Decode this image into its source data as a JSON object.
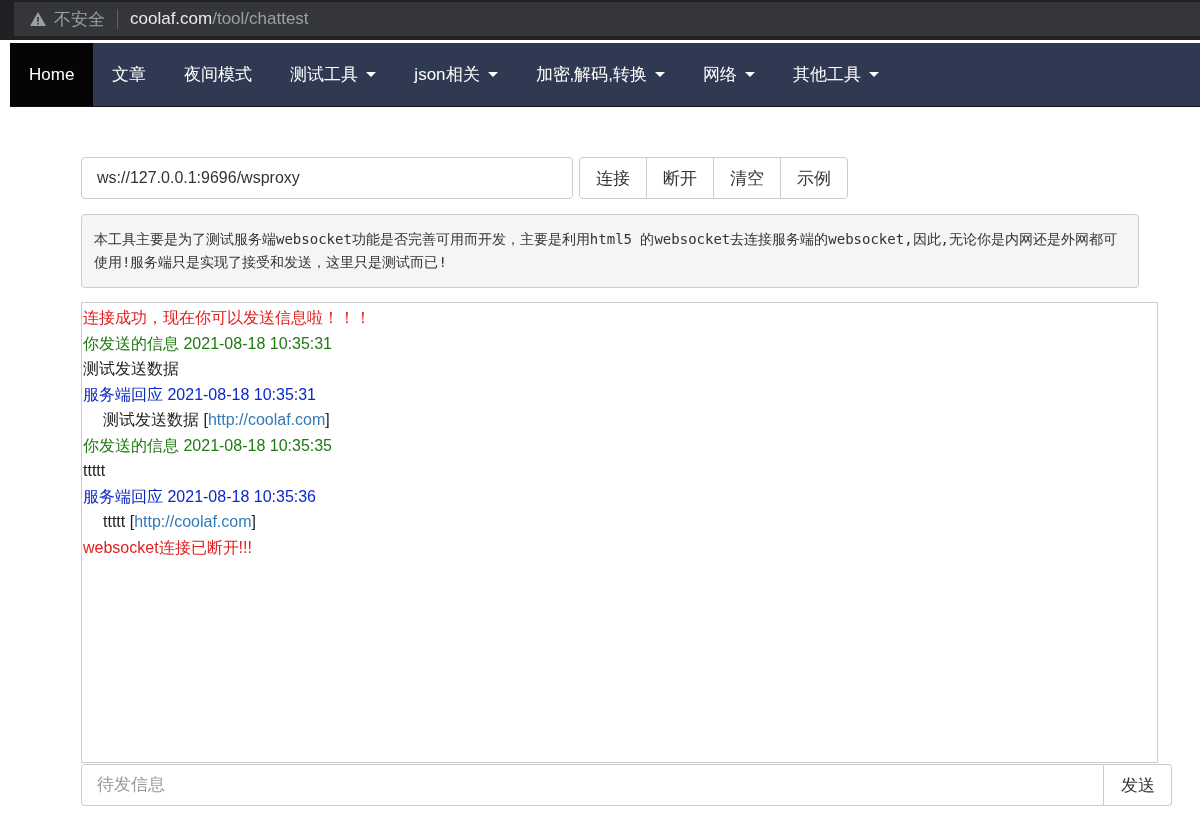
{
  "browser": {
    "security_label": "不安全",
    "url_host": "coolaf.com",
    "url_path": "/tool/chattest"
  },
  "nav": [
    {
      "label": "Home",
      "selected": true,
      "dropdown": false
    },
    {
      "label": "文章",
      "selected": false,
      "dropdown": false
    },
    {
      "label": "夜间模式",
      "selected": false,
      "dropdown": false
    },
    {
      "label": "测试工具",
      "selected": false,
      "dropdown": true
    },
    {
      "label": "json相关",
      "selected": false,
      "dropdown": true
    },
    {
      "label": "加密,解码,转换",
      "selected": false,
      "dropdown": true
    },
    {
      "label": "网络",
      "selected": false,
      "dropdown": true
    },
    {
      "label": "其他工具",
      "selected": false,
      "dropdown": true
    }
  ],
  "address_field": {
    "value": "ws://127.0.0.1:9696/wsproxy"
  },
  "buttons": [
    "连接",
    "断开",
    "清空",
    "示例"
  ],
  "notice": "本工具主要是为了测试服务端websocket功能是否完善可用而开发，主要是利用html5 的websocket去连接服务端的websocket,因此,无论你是内网还是外网都可使用!服务端只是实现了接受和发送，这里只是测试而已!",
  "log": [
    {
      "kind": "status",
      "text": "连接成功，现在你可以发送信息啦！！！"
    },
    {
      "kind": "sent",
      "text": "你发送的信息 2021-08-18 10:35:31"
    },
    {
      "kind": "plain",
      "text": "测试发送数据"
    },
    {
      "kind": "reply",
      "text": "服务端回应 2021-08-18 10:35:31"
    },
    {
      "kind": "echo",
      "text": "测试发送数据 [",
      "link": "http://coolaf.com",
      "suffix": "]"
    },
    {
      "kind": "sent",
      "text": "你发送的信息 2021-08-18 10:35:35"
    },
    {
      "kind": "plain",
      "text": "ttttt"
    },
    {
      "kind": "reply",
      "text": "服务端回应 2021-08-18 10:35:36"
    },
    {
      "kind": "echo",
      "text": "ttttt [",
      "link": "http://coolaf.com",
      "suffix": "]"
    },
    {
      "kind": "status",
      "text": "websocket连接已断开!!!"
    }
  ],
  "message_field": {
    "placeholder": "待发信息"
  },
  "send_button": "发送"
}
